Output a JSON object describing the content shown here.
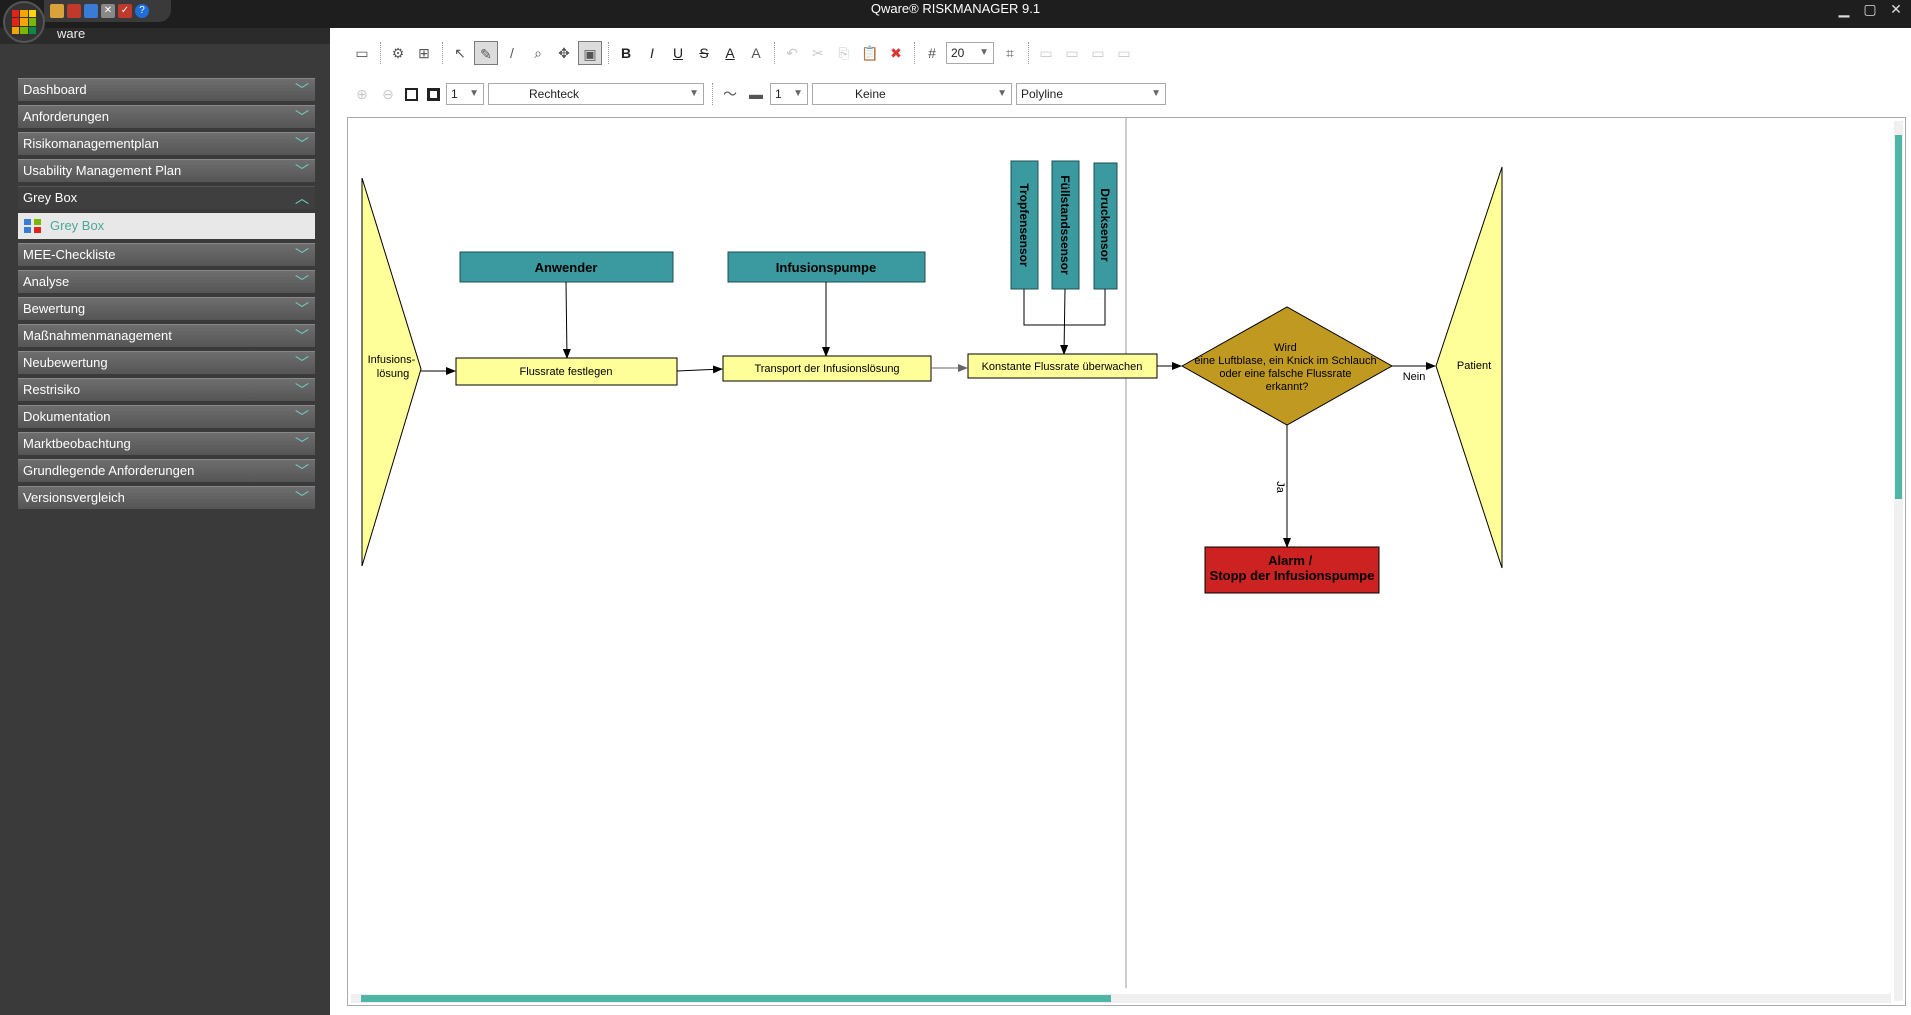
{
  "window": {
    "title": "Qware® RISKMANAGER  9.1",
    "brand": "ware RISKMANAGER"
  },
  "nav": {
    "items": [
      {
        "label": "Dashboard",
        "open": false
      },
      {
        "label": "Anforderungen",
        "open": false
      },
      {
        "label": "Risikomanagementplan",
        "open": false
      },
      {
        "label": "Usability Management Plan",
        "open": false
      },
      {
        "label": "Grey Box",
        "open": true,
        "sub": "Grey Box"
      },
      {
        "label": "MEE-Checkliste",
        "open": false
      },
      {
        "label": "Analyse",
        "open": false
      },
      {
        "label": "Bewertung",
        "open": false
      },
      {
        "label": "Maßnahmenmanagement",
        "open": false
      },
      {
        "label": "Neubewertung",
        "open": false
      },
      {
        "label": "Restrisiko",
        "open": false
      },
      {
        "label": "Dokumentation",
        "open": false
      },
      {
        "label": "Marktbeobachtung",
        "open": false
      },
      {
        "label": "Grundlegende Anforderungen",
        "open": false
      },
      {
        "label": "Versionsvergleich",
        "open": false
      }
    ]
  },
  "toolbar": {
    "font_size": "20",
    "line_width_1": "1",
    "shape": "Rechteck",
    "line_width_2": "1",
    "arrow": "Keine",
    "connector": "Polyline",
    "bold": "B",
    "italic": "I",
    "underline": "U",
    "strike": "S",
    "font_color": "A"
  },
  "diagram": {
    "source": "Infusions-\nlösung",
    "anwender": "Anwender",
    "infusionspumpe": "Infusionspumpe",
    "sensor1": "Tropfensensor",
    "sensor2": "Füllstandssensor",
    "sensor3": "Drucksensor",
    "step1": "Flussrate festlegen",
    "step2": "Transport der Infusionslösung",
    "step3": "Konstante Flussrate überwachen",
    "decision": [
      "Wird",
      "eine Luftblase, ein Knick im Schlauch",
      "oder eine falsche Flussrate",
      "erkannt?"
    ],
    "no_label": "Nein",
    "yes_label": "Ja",
    "target": "Patient",
    "alarm": [
      "Alarm /",
      "Stopp der Infusionspumpe"
    ]
  },
  "colors": {
    "teal_box": "#3b9aa0",
    "yellow_box": "#ffff99",
    "decision": "#c0a020",
    "alarm": "#cc2222",
    "accent": "#4fb5a5"
  }
}
